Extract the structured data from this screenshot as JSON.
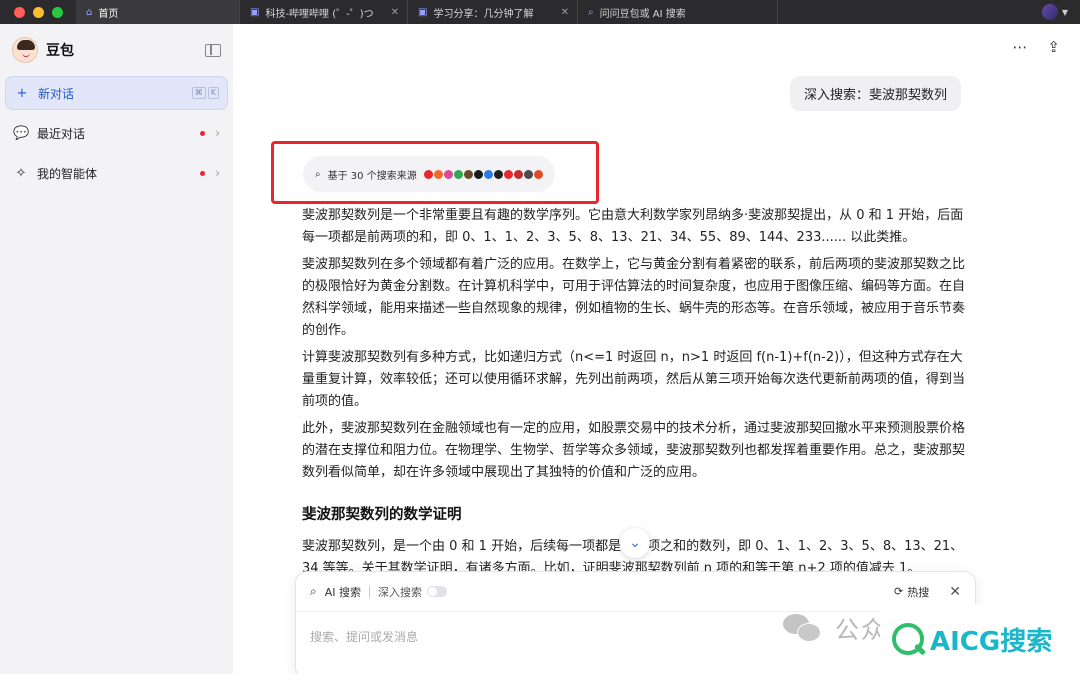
{
  "tabs": [
    {
      "label": "首页",
      "icon": "home-icon",
      "active": true
    },
    {
      "label": "科技-哔哩哔哩 (゜-゜)つ",
      "icon": "bilibili-icon",
      "active": false
    },
    {
      "label": "学习分享：几分钟了解",
      "icon": "bilibili-icon",
      "active": false
    },
    {
      "label": "问问豆包或 AI 搜索",
      "icon": "search-icon",
      "active": false
    }
  ],
  "sidebar": {
    "brand": "豆包",
    "new_chat": "新对话",
    "new_chat_shortcut": [
      "⌘",
      "K"
    ],
    "recent": "最近对话",
    "agents": "我的智能体"
  },
  "conversation": {
    "user_query": "深入搜索：斐波那契数列",
    "sources_label": "基于 30 个搜索来源",
    "source_colors": [
      "#e8262d",
      "#f06a2b",
      "#d94a9a",
      "#2fa84f",
      "#6b4a2a",
      "#1a1a1a",
      "#2a7de1",
      "#1f1f1f",
      "#e8262d",
      "#c12c2c",
      "#4a4a4a",
      "#e34a2a"
    ],
    "paragraphs": [
      "斐波那契数列是一个非常重要且有趣的数学序列。它由意大利数学家列昂纳多·斐波那契提出，从 0 和 1 开始，后面每一项都是前两项的和，即 0、1、1、2、3、5、8、13、21、34、55、89、144、233...... 以此类推。",
      "斐波那契数列在多个领域都有着广泛的应用。在数学上，它与黄金分割有着紧密的联系，前后两项的斐波那契数之比的极限恰好为黄金分割数。在计算机科学中，可用于评估算法的时间复杂度，也应用于图像压缩、编码等方面。在自然科学领域，能用来描述一些自然现象的规律，例如植物的生长、蜗牛壳的形态等。在音乐领域，被应用于音乐节奏的创作。",
      "计算斐波那契数列有多种方式，比如递归方式（n<=1 时返回 n，n>1 时返回 f(n-1)+f(n-2)），但这种方式存在大量重复计算，效率较低；还可以使用循环求解，先列出前两项，然后从第三项开始每次迭代更新前两项的值，得到当前项的值。",
      "此外，斐波那契数列在金融领域也有一定的应用，如股票交易中的技术分析，通过斐波那契回撤水平来预测股票价格的潜在支撑位和阻力位。在物理学、生物学、哲学等众多领域，斐波那契数列也都发挥着重要作用。总之，斐波那契数列看似简单，却在许多领域中展现出了其独特的价值和广泛的应用。"
    ],
    "section_heading": "斐波那契数列的数学证明",
    "section_paragraph": "斐波那契数列，是一个由 0 和 1 开始，后续每一项都是前两项之和的数列，即 0、1、1、2、3、5、8、13、21、34 等等。关于其数学证明，有诸多方面。比如，证明斐波那契数列前 n 项的和等于第 n+2 项的值减去 1。"
  },
  "composer": {
    "ai_search": "AI 搜索",
    "deep_search": "深入搜索",
    "hot_search": "热搜",
    "placeholder": "搜索、提问或发消息"
  },
  "watermark": {
    "account": "公众号",
    "brand": "AICG搜索"
  }
}
